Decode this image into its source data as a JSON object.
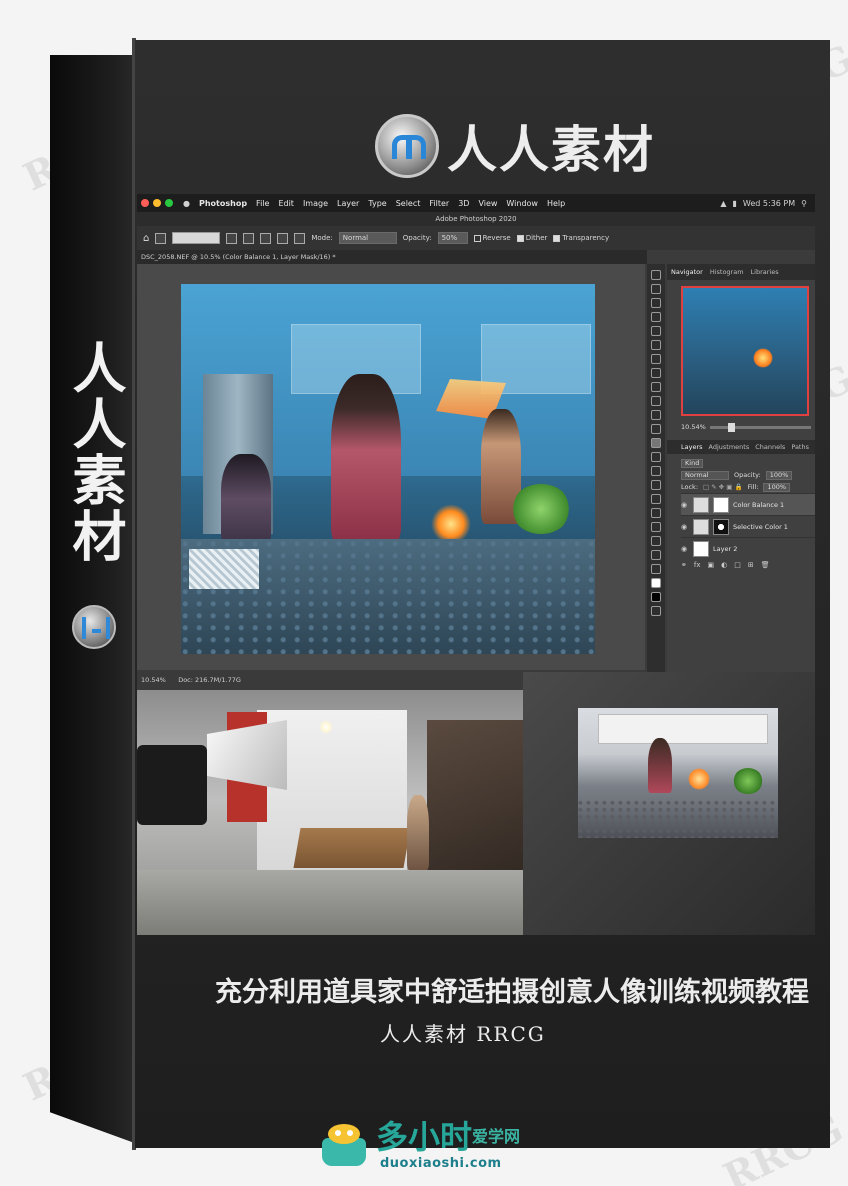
{
  "brand": {
    "name": "人人素材"
  },
  "spine": {
    "title": "人人素材"
  },
  "photoshop": {
    "menubar": {
      "app": "Photoshop",
      "items": [
        "File",
        "Edit",
        "Image",
        "Layer",
        "Type",
        "Select",
        "Filter",
        "3D",
        "View",
        "Window",
        "Help"
      ],
      "clock": "Wed 5:36 PM"
    },
    "window_title": "Adobe Photoshop 2020",
    "options": {
      "mode_label": "Mode:",
      "mode_value": "Normal",
      "opacity_label": "Opacity:",
      "opacity_value": "50%",
      "reverse": "Reverse",
      "dither": "Dither",
      "transparency": "Transparency"
    },
    "document_tab": "DSC_2058.NEF @ 10.5% (Color Balance 1, Layer Mask/16) *",
    "status": {
      "zoom": "10.54%",
      "doc": "Doc: 216.7M/1.77G"
    },
    "panel_tabs": [
      "Navigator",
      "Histogram",
      "Libraries"
    ],
    "navigator_zoom": "10.54%",
    "layer_tabs": [
      "Layers",
      "Adjustments",
      "Channels",
      "Paths"
    ],
    "layers_controls": {
      "kind": "Kind",
      "blend": "Normal",
      "opacity_label": "Opacity:",
      "opacity_value": "100%",
      "lock_label": "Lock:",
      "fill_label": "Fill:",
      "fill_value": "100%"
    },
    "layers": [
      {
        "name": "Color Balance 1"
      },
      {
        "name": "Selective Color 1"
      },
      {
        "name": "Layer 2"
      }
    ]
  },
  "course": {
    "title": "充分利用道具家中舒适拍摄创意人像训练视频教程",
    "subtitle": "人人素材 RRCG"
  },
  "watermark": {
    "text": "RRCG"
  },
  "footer": {
    "cn_main": "多小时",
    "cn_small": "爱学网",
    "domain": "duoxiaoshi.com"
  },
  "colors": {
    "box": "#262626",
    "accent_blue": "#2a86d6",
    "footer_teal": "#27a79a",
    "mac_red": "#ff5f57",
    "mac_yellow": "#febc2e",
    "mac_green": "#28c840"
  }
}
